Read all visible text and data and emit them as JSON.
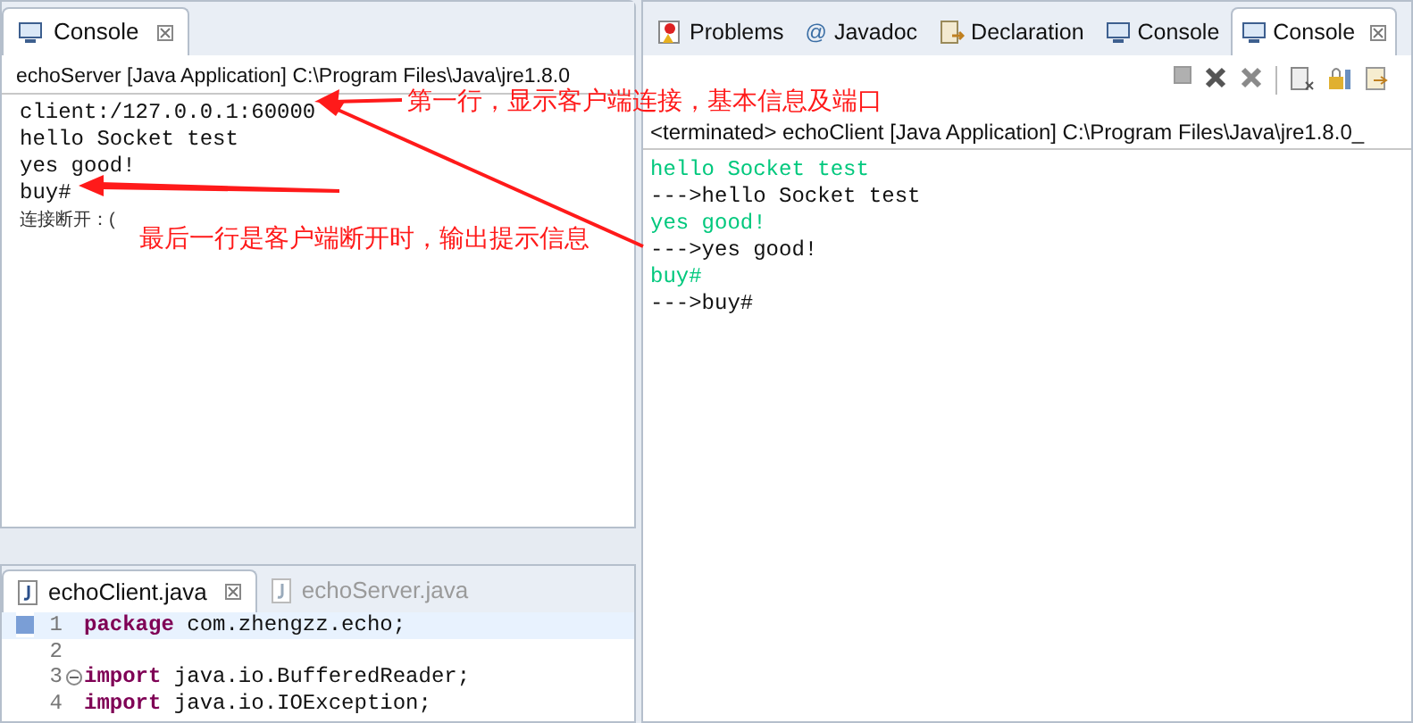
{
  "server_console": {
    "tab": {
      "label": "Console",
      "selected": true
    },
    "header": "echoServer [Java Application] C:\\Program Files\\Java\\jre1.8.0",
    "lines": [
      "client:/127.0.0.1:60000",
      "hello Socket test",
      "yes good!",
      "buy#"
    ],
    "note": "连接断开：("
  },
  "client_console": {
    "tabs": [
      {
        "label": "Problems",
        "kind": "problems",
        "selected": false
      },
      {
        "label": "Javadoc",
        "kind": "javadoc",
        "glyph": "@",
        "selected": false
      },
      {
        "label": "Declaration",
        "kind": "declaration",
        "selected": false
      },
      {
        "label": "Console",
        "kind": "console",
        "selected": false
      },
      {
        "label": "Console",
        "kind": "console",
        "selected": true
      }
    ],
    "header": "<terminated> echoClient [Java Application] C:\\Program Files\\Java\\jre1.8.0_",
    "lines": [
      {
        "text": "hello Socket test",
        "kind": "input"
      },
      {
        "text": "--->hello Socket test",
        "kind": "output"
      },
      {
        "text": "yes good!",
        "kind": "input"
      },
      {
        "text": "--->yes good!",
        "kind": "output"
      },
      {
        "text": "buy#",
        "kind": "input"
      },
      {
        "text": "--->buy#",
        "kind": "output"
      }
    ]
  },
  "editor": {
    "tabs": [
      {
        "label": "echoClient.java",
        "selected": true
      },
      {
        "label": "echoServer.java",
        "selected": false
      }
    ],
    "lines": [
      {
        "number": "1",
        "keyword": "package",
        "rest": " com.zhengzz.echo;",
        "current": true,
        "fold_toggle": false
      },
      {
        "number": "2",
        "current": false,
        "fold_toggle": false
      },
      {
        "number": "3",
        "keyword": "import",
        "rest": " java.io.BufferedReader;",
        "current": false,
        "fold_toggle": true
      },
      {
        "number": "4",
        "keyword": "import",
        "rest": " java.io.IOException;",
        "current": false,
        "fold_toggle": false
      }
    ]
  },
  "annotations": [
    {
      "text": "第一行，显示客户端连接，基本信息及端口"
    },
    {
      "text": "最后一行是客户端断开时，输出提示信息"
    }
  ]
}
